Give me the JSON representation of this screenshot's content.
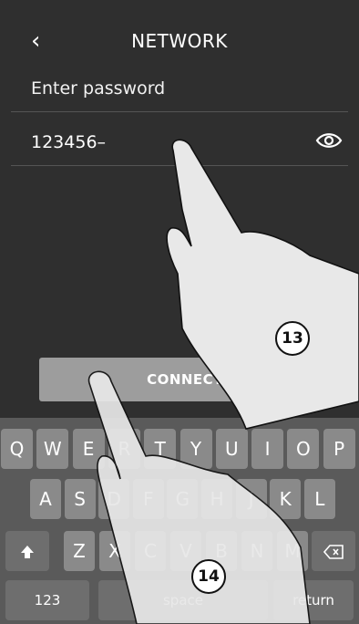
{
  "header": {
    "back_icon": "chevron-left-icon",
    "title": "NETWORK"
  },
  "subtitle": "Enter password",
  "password": {
    "value": "123456–",
    "visibility_icon": "eye-icon"
  },
  "connect_label": "CONNECT",
  "keyboard": {
    "row1": [
      "Q",
      "W",
      "E",
      "R",
      "T",
      "Y",
      "U",
      "I",
      "O",
      "P"
    ],
    "row2": [
      "A",
      "S",
      "D",
      "F",
      "G",
      "H",
      "J",
      "K",
      "L"
    ],
    "row3": [
      "Z",
      "X",
      "C",
      "V",
      "B",
      "N",
      "M"
    ],
    "shift_icon": "shift-icon",
    "backspace_icon": "backspace-icon",
    "numbers_label": "123",
    "space_label": "space",
    "return_label": "return"
  },
  "callouts": [
    "13",
    "14"
  ],
  "colors": {
    "background": "#2f2f2f",
    "button": "#9d9d9d",
    "keyboard": "#5a5a5a",
    "key": "#8a8a8a"
  }
}
